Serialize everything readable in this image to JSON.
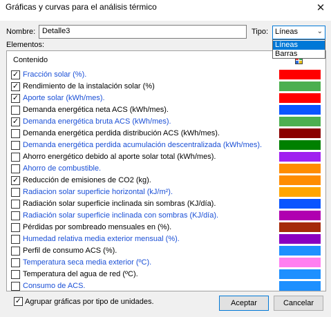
{
  "window": {
    "title": "Gráficas y curvas para el análisis térmico",
    "close_glyph": "✕"
  },
  "form": {
    "name_label": "Nombre:",
    "name_value": "Detalle3",
    "tipo_label": "Tipo:",
    "tipo_value": "Líneas",
    "tipo_options": [
      "Líneas",
      "Barras"
    ],
    "elements_label": "Elementos:"
  },
  "list": {
    "header": "Contenido",
    "header_icon": "color-grid-icon",
    "items": [
      {
        "label": "Fracción solar (%).",
        "checked": true,
        "blue": true,
        "color": "#ff0000"
      },
      {
        "label": "Rendimiento de la instalación solar (%)",
        "checked": true,
        "blue": false,
        "color": "#4caf50"
      },
      {
        "label": "Aporte solar (kWh/mes).",
        "checked": true,
        "blue": true,
        "color": "#ff0000"
      },
      {
        "label": "Demanda energética neta ACS (kWh/mes).",
        "checked": false,
        "blue": false,
        "color": "#0a55ff"
      },
      {
        "label": "Demanda energética bruta ACS (kWh/mes).",
        "checked": true,
        "blue": true,
        "color": "#4caf50"
      },
      {
        "label": "Demanda energética perdida distribución ACS (kWh/mes).",
        "checked": false,
        "blue": false,
        "color": "#8b0000"
      },
      {
        "label": "Demanda energética perdida acumulación descentralizada (kWh/mes).",
        "checked": false,
        "blue": true,
        "color": "#008000"
      },
      {
        "label": "Ahorro energético debido al aporte solar total (kWh/mes).",
        "checked": false,
        "blue": false,
        "color": "#a020f0"
      },
      {
        "label": "Ahorro de combustible.",
        "checked": false,
        "blue": true,
        "color": "#ff8c00"
      },
      {
        "label": "Reducción de emisiones de CO2 (kg).",
        "checked": true,
        "blue": false,
        "color": "#ff8c00"
      },
      {
        "label": "Radiacion solar superficie horizontal (kJ/m²).",
        "checked": false,
        "blue": true,
        "color": "#ffa500"
      },
      {
        "label": "Radiación solar superficie inclinada sin sombras (KJ/día).",
        "checked": false,
        "blue": false,
        "color": "#0a55ff"
      },
      {
        "label": "Radiación solar superficie inclinada con sombras (KJ/día).",
        "checked": false,
        "blue": true,
        "color": "#b000b0"
      },
      {
        "label": "Pérdidas por sombreado mensuales en (%).",
        "checked": false,
        "blue": false,
        "color": "#a52a0a"
      },
      {
        "label": "Humedad relativa media exterior mensual (%).",
        "checked": false,
        "blue": true,
        "color": "#8a00c0"
      },
      {
        "label": "Perfil de consumo ACS (%).",
        "checked": false,
        "blue": false,
        "color": "#1e90ff"
      },
      {
        "label": "Temperatura seca media exterior (ºC).",
        "checked": false,
        "blue": true,
        "color": "#ff7ff0"
      },
      {
        "label": "Temperatura del agua de red (ºC).",
        "checked": false,
        "blue": false,
        "color": "#1e90ff"
      },
      {
        "label": "Consumo de ACS.",
        "checked": false,
        "blue": true,
        "color": "#1e90ff"
      }
    ]
  },
  "footer": {
    "group_label": "Agrupar gráficas por tipo de unidades.",
    "group_checked": true,
    "accept_label": "Aceptar",
    "cancel_label": "Cancelar"
  },
  "checkmark": "✓",
  "chevron": "⌄"
}
